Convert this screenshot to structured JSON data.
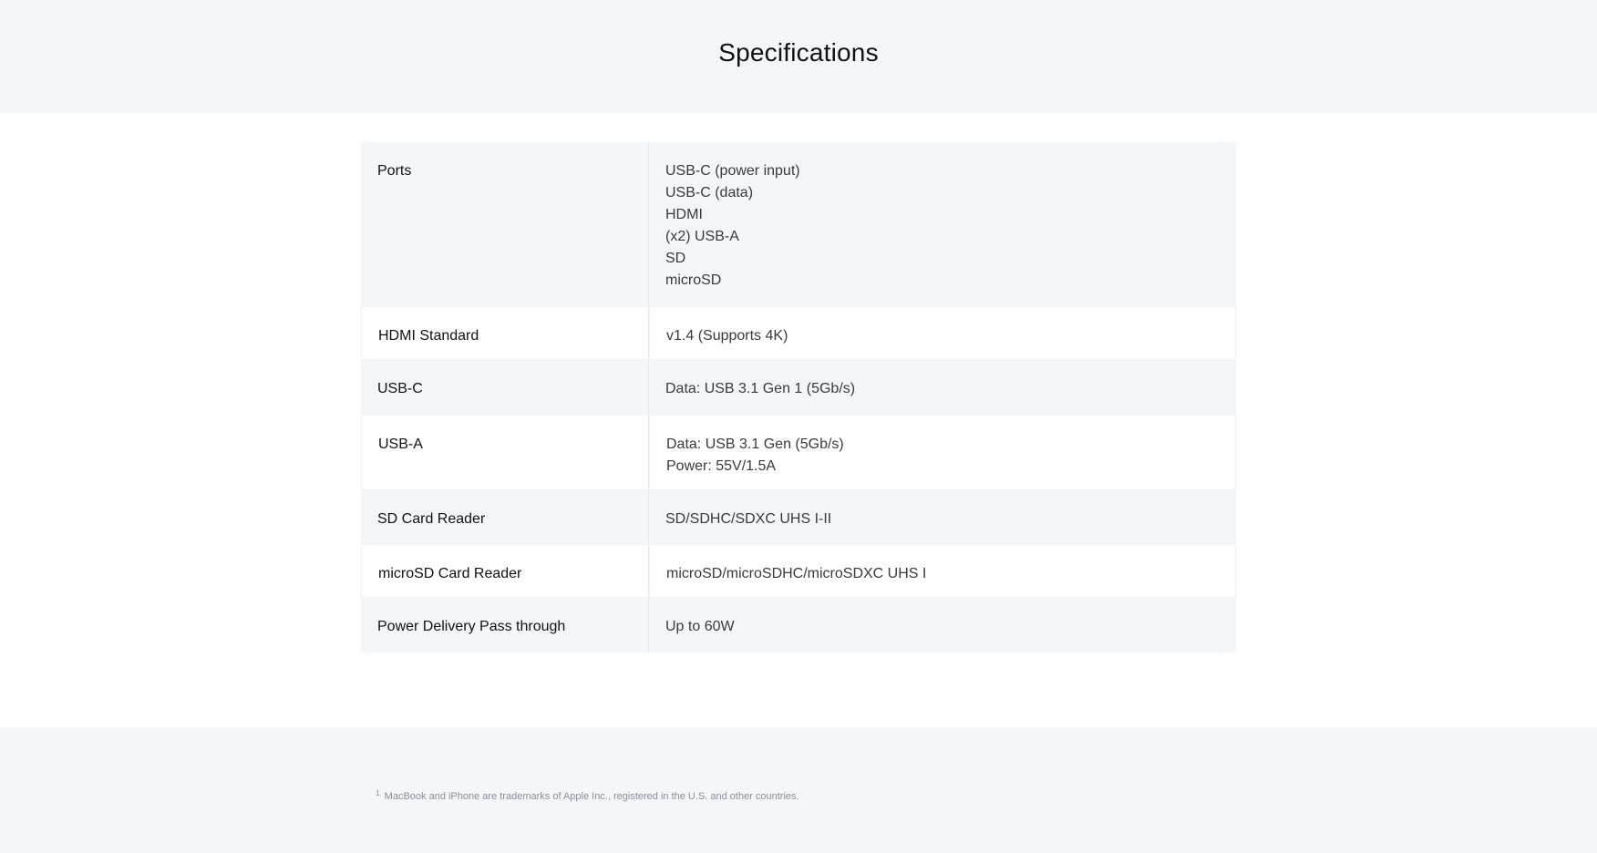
{
  "header": {
    "title": "Specifications"
  },
  "specs": [
    {
      "name": "Ports",
      "values": [
        "USB-C (power input)",
        "USB-C (data)",
        "HDMI",
        "(x2) USB-A",
        "SD",
        "microSD"
      ]
    },
    {
      "name": "HDMI Standard",
      "values": [
        "v1.4 (Supports 4K)"
      ]
    },
    {
      "name": "USB-C",
      "values": [
        "Data: USB 3.1 Gen 1 (5Gb/s)"
      ]
    },
    {
      "name": "USB-A",
      "values": [
        "Data: USB 3.1 Gen (5Gb/s)",
        "Power: 55V/1.5A"
      ]
    },
    {
      "name": "SD Card Reader",
      "values": [
        "SD/SDHC/SDXC UHS I-II"
      ]
    },
    {
      "name": "microSD Card Reader",
      "values": [
        "microSD/microSDHC/microSDXC UHS I"
      ]
    },
    {
      "name": "Power Delivery Pass through",
      "values": [
        "Up to 60W"
      ]
    }
  ],
  "footer": {
    "footnote_number": "1.",
    "footnote_text": "MacBook and iPhone are trademarks of Apple Inc., registered in the U.S. and other countries."
  },
  "colors": {
    "shaded_background": "#f4f7fa",
    "text_primary": "#111111",
    "text_secondary": "#3a3a3a",
    "footnote_text": "#8a8f96"
  }
}
